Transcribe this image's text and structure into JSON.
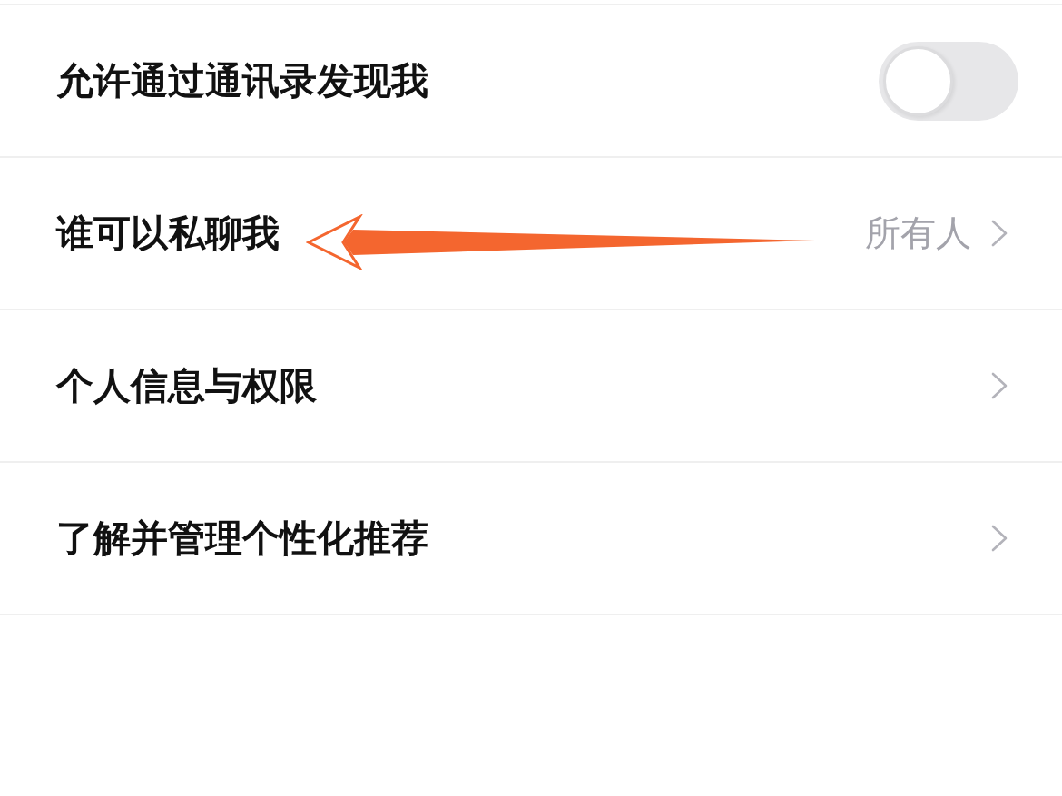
{
  "settings": [
    {
      "kind": "toggle",
      "label": "允许通过通讯录发现我",
      "on": false
    },
    {
      "kind": "link",
      "label": "谁可以私聊我",
      "value": "所有人"
    },
    {
      "kind": "link",
      "label": "个人信息与权限"
    },
    {
      "kind": "link",
      "label": "了解并管理个性化推荐"
    }
  ]
}
